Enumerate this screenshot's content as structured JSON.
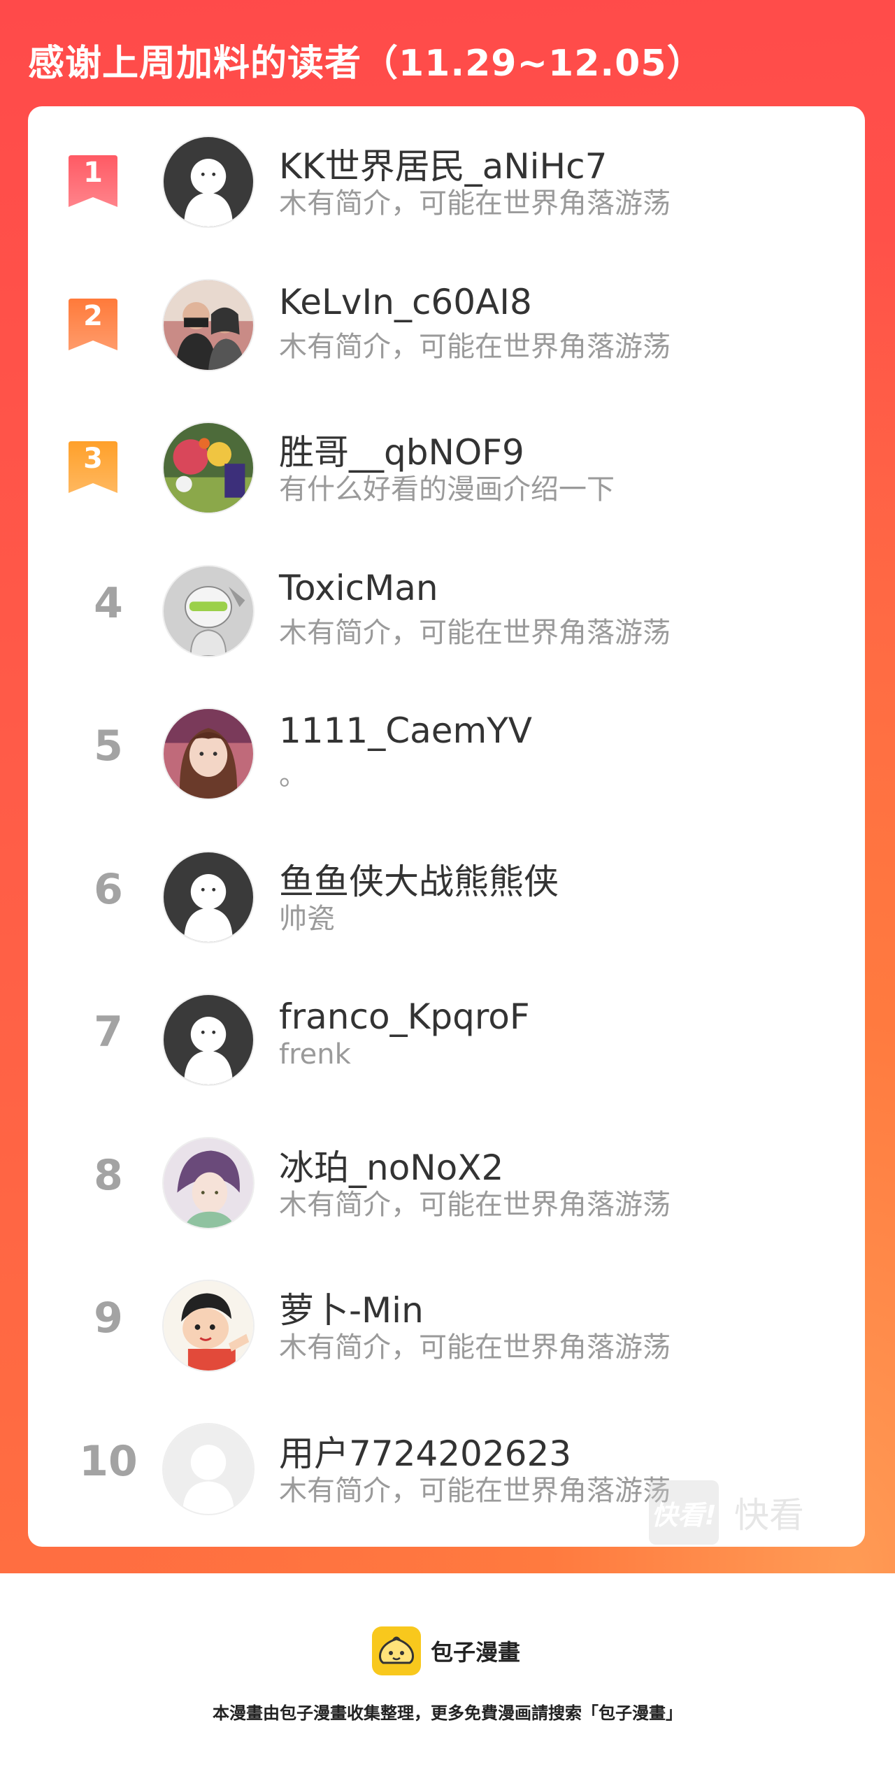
{
  "header": {
    "title": "感谢上周加料的读者（11.29~12.05）",
    "banner_colors": [
      "#ff4a4a",
      "#ff7a3f"
    ]
  },
  "ranking": [
    {
      "rank": "1",
      "name": "KK世界居民_aNiHc7",
      "bio": "木有简介，可能在世界角落游荡",
      "avatar": "default-avatar",
      "badge_color": "#ff5a64"
    },
    {
      "rank": "2",
      "name": "KeLvIn_c60AI8",
      "bio": "木有简介，可能在世界角落游荡",
      "avatar": "photo-avatar",
      "badge_color": "#ff7a3a"
    },
    {
      "rank": "3",
      "name": "胜哥__qbNOF9",
      "bio": "有什么好看的漫画介绍一下",
      "avatar": "illustration-avatar",
      "badge_color": "#ffa02a"
    },
    {
      "rank": "4",
      "name": "ToxicMan",
      "bio": "木有简介，可能在世界角落游荡",
      "avatar": "robot-avatar"
    },
    {
      "rank": "5",
      "name": "1111_CaemYV",
      "bio": "。",
      "avatar": "anime-girl-avatar"
    },
    {
      "rank": "6",
      "name": "鱼鱼侠大战熊熊侠",
      "bio": "帅瓷",
      "avatar": "default-avatar"
    },
    {
      "rank": "7",
      "name": "franco_KpqroF",
      "bio": "frenk",
      "avatar": "default-avatar"
    },
    {
      "rank": "8",
      "name": "冰珀_noNoX2",
      "bio": "木有简介，可能在世界角落游荡",
      "avatar": "anime-boy-avatar"
    },
    {
      "rank": "9",
      "name": "萝卜-Min",
      "bio": "木有简介，可能在世界角落游荡",
      "avatar": "cartoon-avatar"
    },
    {
      "rank": "10",
      "name": "用户7724202623",
      "bio": "木有简介，可能在世界角落游荡",
      "avatar": "placeholder-avatar"
    }
  ],
  "watermark": {
    "logo": "快看!",
    "text": "快看"
  },
  "footer": {
    "brand": "包子漫畫",
    "note": "本漫畫由包子漫畫收集整理，更多免費漫画請搜索「包子漫畫」"
  }
}
